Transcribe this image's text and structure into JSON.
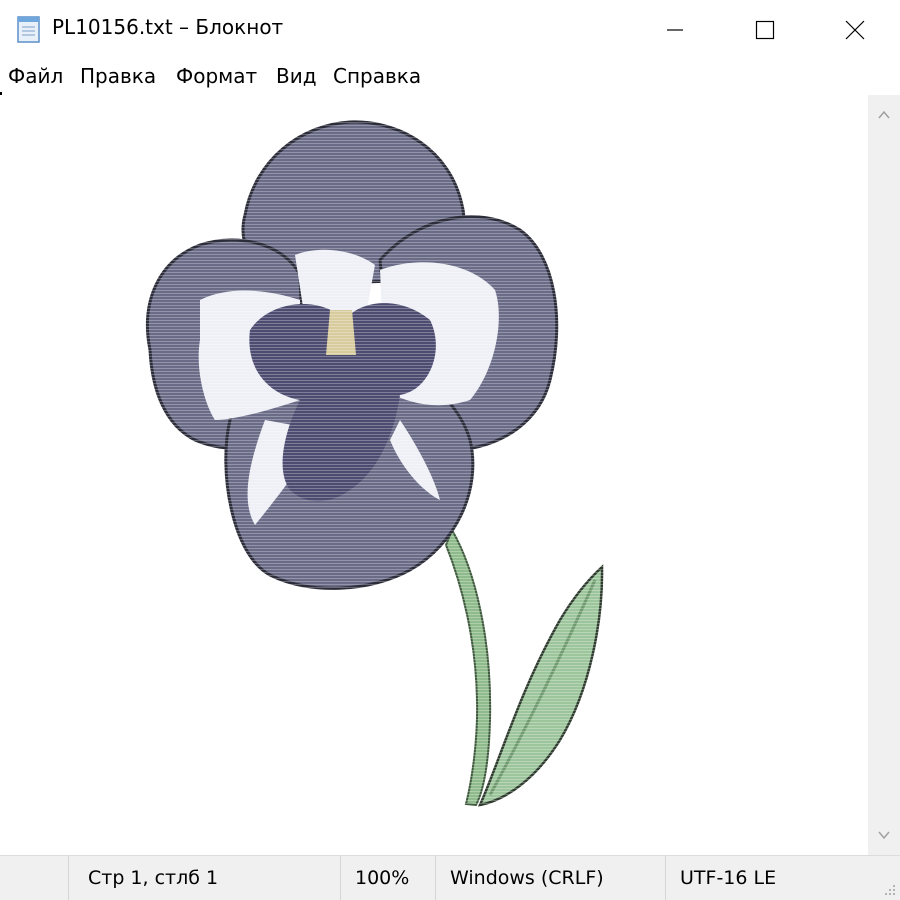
{
  "window": {
    "title": "PL10156.txt – Блокнот",
    "icon": "notepad-icon",
    "controls": [
      "minimize-icon",
      "maximize-icon",
      "close-icon"
    ]
  },
  "menu": {
    "items": [
      {
        "label": "Файл"
      },
      {
        "label": "Правка"
      },
      {
        "label": "Формат"
      },
      {
        "label": "Вид"
      },
      {
        "label": "Справка"
      }
    ]
  },
  "document": {
    "content": "ASCII-art pansy rendered as coloured text",
    "colors": {
      "petal": "#6a6b86",
      "petal_dark": "#4d4c70",
      "petal_white": "#eef0f6",
      "center_yellow": "#d8cc9e",
      "stem": "#8fbb8c",
      "outline": "#2c2d3a"
    }
  },
  "statusbar": {
    "position": "Стр 1, стлб 1",
    "zoom": "100%",
    "line_endings": "Windows (CRLF)",
    "encoding": "UTF-16 LE"
  }
}
